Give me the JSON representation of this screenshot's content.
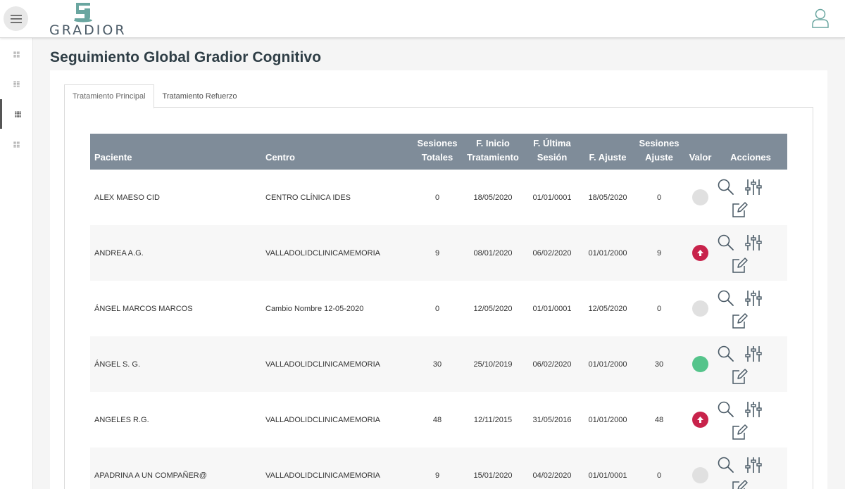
{
  "header": {
    "brand": "GRADIOR",
    "colors": {
      "brand_teal": "#6aa6a0",
      "brand_text": "#4a5a66"
    }
  },
  "sidebar": {
    "items": [
      {
        "icon": "grid-icon",
        "active": false
      },
      {
        "icon": "grid-icon",
        "active": false
      },
      {
        "icon": "grid-icon",
        "active": true
      },
      {
        "icon": "grid-icon",
        "active": false
      }
    ]
  },
  "page": {
    "title": "Seguimiento Global Gradior Cognitivo"
  },
  "tabs": [
    {
      "label": "Tratamiento Principal",
      "active": true
    },
    {
      "label": "Tratamiento Refuerzo",
      "active": false
    }
  ],
  "table": {
    "header_color": "#7f8c99",
    "columns": {
      "paciente": "Paciente",
      "centro": "Centro",
      "sesiones_1": "Sesiones",
      "sesiones_2": "Totales",
      "inicio_1": "F. Inicio",
      "inicio_2": "Tratamiento",
      "ultima_1": "F. Última",
      "ultima_2": "Sesión",
      "ajuste": "F. Ajuste",
      "ses_ajuste_1": "Sesiones",
      "ses_ajuste_2": "Ajuste",
      "valor": "Valor",
      "acciones": "Acciones"
    },
    "rows": [
      {
        "paciente": "ALEX MAESO CID",
        "centro": "CENTRO CLÍNICA IDES",
        "sesiones": "0",
        "inicio": "18/05/2020",
        "ultima": "01/01/0001",
        "ajuste": "18/05/2020",
        "ses_ajuste": "0",
        "valor": "empty"
      },
      {
        "paciente": "ANDREA A.G.",
        "centro": "VALLADOLIDCLINICAMEMORIA",
        "sesiones": "9",
        "inicio": "08/01/2020",
        "ultima": "06/02/2020",
        "ajuste": "01/01/2000",
        "ses_ajuste": "9",
        "valor": "up"
      },
      {
        "paciente": "ÁNGEL MARCOS MARCOS",
        "centro": "Cambio Nombre 12-05-2020",
        "sesiones": "0",
        "inicio": "12/05/2020",
        "ultima": "01/01/0001",
        "ajuste": "12/05/2020",
        "ses_ajuste": "0",
        "valor": "empty"
      },
      {
        "paciente": "ÁNGEL S. G.",
        "centro": "VALLADOLIDCLINICAMEMORIA",
        "sesiones": "30",
        "inicio": "25/10/2019",
        "ultima": "06/02/2020",
        "ajuste": "01/01/2000",
        "ses_ajuste": "30",
        "valor": "ok"
      },
      {
        "paciente": "ANGELES R.G.",
        "centro": "VALLADOLIDCLINICAMEMORIA",
        "sesiones": "48",
        "inicio": "12/11/2015",
        "ultima": "31/05/2016",
        "ajuste": "01/01/2000",
        "ses_ajuste": "48",
        "valor": "up"
      },
      {
        "paciente": "APADRINA A UN COMPAÑER@",
        "centro": "VALLADOLIDCLINICAMEMORIA",
        "sesiones": "9",
        "inicio": "15/01/2020",
        "ultima": "04/02/2020",
        "ajuste": "01/01/0001",
        "ses_ajuste": "0",
        "valor": "empty"
      }
    ],
    "valor_colors": {
      "empty": "#e0e0e0",
      "up": "#c8234b",
      "ok": "#55c48b"
    },
    "action_icons": [
      "search-icon",
      "adjust-icon",
      "edit-icon"
    ]
  }
}
